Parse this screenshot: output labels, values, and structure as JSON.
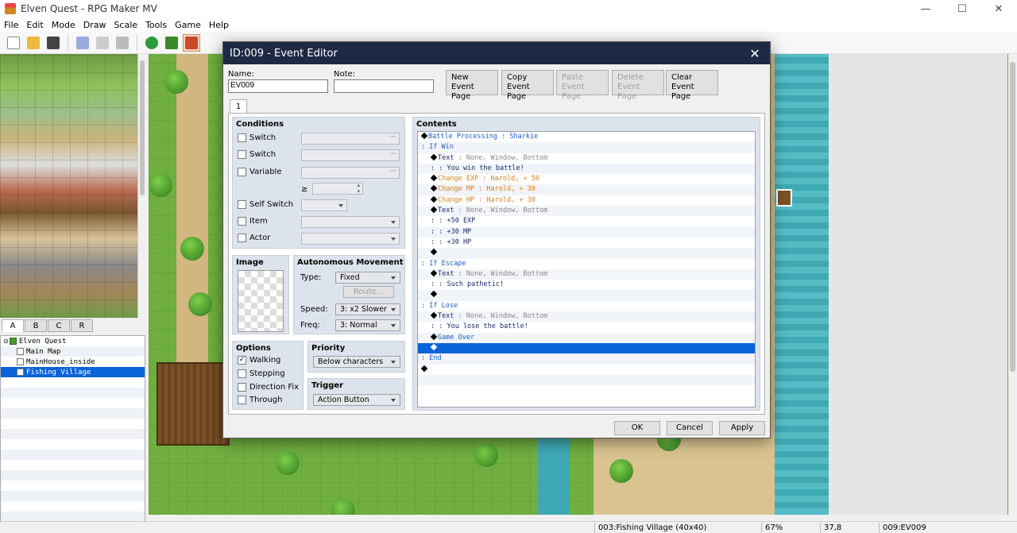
{
  "window": {
    "title": "Elven Quest - RPG Maker MV"
  },
  "menu": [
    "File",
    "Edit",
    "Mode",
    "Draw",
    "Scale",
    "Tools",
    "Game",
    "Help"
  ],
  "tileset_tabs": [
    "A",
    "B",
    "C",
    "R"
  ],
  "map_tree": [
    {
      "label": "Elven Quest",
      "indent": 0,
      "root": true
    },
    {
      "label": "Main Map",
      "indent": 1
    },
    {
      "label": "MainHouse_inside",
      "indent": 1
    },
    {
      "label": "Fishing Village",
      "indent": 1,
      "selected": true
    }
  ],
  "status": {
    "map": "003:Fishing Village (40x40)",
    "zoom": "67%",
    "coords": "37,8",
    "event": "009:EV009"
  },
  "dialog": {
    "title": "ID:009 - Event Editor",
    "name_label": "Name:",
    "name_value": "EV009",
    "note_label": "Note:",
    "note_value": "",
    "buttons": {
      "new": [
        "New",
        "Event Page"
      ],
      "copy": [
        "Copy",
        "Event Page"
      ],
      "paste": [
        "Paste",
        "Event Page"
      ],
      "delete": [
        "Delete",
        "Event Page"
      ],
      "clear": [
        "Clear",
        "Event Page"
      ]
    },
    "page_tab": "1",
    "conditions": {
      "title": "Conditions",
      "switch1": "Switch",
      "switch2": "Switch",
      "variable": "Variable",
      "gte": "≥",
      "self_switch": "Self Switch",
      "item": "Item",
      "actor": "Actor"
    },
    "image_title": "Image",
    "movement": {
      "title": "Autonomous Movement",
      "type_label": "Type:",
      "type_value": "Fixed",
      "route": "Route...",
      "speed_label": "Speed:",
      "speed_value": "3: x2 Slower",
      "freq_label": "Freq:",
      "freq_value": "3: Normal"
    },
    "options": {
      "title": "Options",
      "walking": "Walking",
      "stepping": "Stepping",
      "direction_fix": "Direction Fix",
      "through": "Through"
    },
    "priority": {
      "title": "Priority",
      "value": "Below characters"
    },
    "trigger": {
      "title": "Trigger",
      "value": "Action Button"
    },
    "contents_title": "Contents",
    "commands": [
      {
        "indent": 0,
        "diamond": true,
        "parts": [
          [
            "Battle Processing : Sharkie",
            "blue"
          ]
        ]
      },
      {
        "indent": 0,
        "parts": [
          [
            ": If Win",
            "blue"
          ]
        ]
      },
      {
        "indent": 1,
        "diamond": true,
        "parts": [
          [
            "Text",
            "navy"
          ],
          [
            " : None, Window, Bottom",
            "gray"
          ]
        ]
      },
      {
        "indent": 1,
        "parts": [
          [
            ":      : You win the battle!",
            "navy"
          ]
        ]
      },
      {
        "indent": 1,
        "diamond": true,
        "parts": [
          [
            "Change EXP : Harold, + 50",
            "orange"
          ]
        ]
      },
      {
        "indent": 1,
        "diamond": true,
        "parts": [
          [
            "Change MP : Harold, + 30",
            "orange"
          ]
        ]
      },
      {
        "indent": 1,
        "diamond": true,
        "parts": [
          [
            "Change HP : Harold, + 30",
            "orange"
          ]
        ]
      },
      {
        "indent": 1,
        "diamond": true,
        "parts": [
          [
            "Text",
            "navy"
          ],
          [
            " : None, Window, Bottom",
            "gray"
          ]
        ]
      },
      {
        "indent": 1,
        "parts": [
          [
            ":      : +50 EXP",
            "navy"
          ]
        ]
      },
      {
        "indent": 1,
        "parts": [
          [
            ":      : +30 MP",
            "navy"
          ]
        ]
      },
      {
        "indent": 1,
        "parts": [
          [
            ":      : +30 HP",
            "navy"
          ]
        ]
      },
      {
        "indent": 1,
        "diamond": true,
        "parts": []
      },
      {
        "indent": 0,
        "parts": [
          [
            ": If Escape",
            "blue"
          ]
        ]
      },
      {
        "indent": 1,
        "diamond": true,
        "parts": [
          [
            "Text",
            "navy"
          ],
          [
            " : None, Window, Bottom",
            "gray"
          ]
        ]
      },
      {
        "indent": 1,
        "parts": [
          [
            ":      : Such pathetic!",
            "navy"
          ]
        ]
      },
      {
        "indent": 1,
        "diamond": true,
        "parts": []
      },
      {
        "indent": 0,
        "parts": [
          [
            ": If Lose",
            "blue"
          ]
        ]
      },
      {
        "indent": 1,
        "diamond": true,
        "parts": [
          [
            "Text",
            "navy"
          ],
          [
            " : None, Window, Bottom",
            "gray"
          ]
        ]
      },
      {
        "indent": 1,
        "parts": [
          [
            ":      : You lose the battle!",
            "navy"
          ]
        ]
      },
      {
        "indent": 1,
        "diamond": true,
        "parts": [
          [
            "Game Over",
            "blue"
          ]
        ]
      },
      {
        "indent": 1,
        "diamond": true,
        "parts": [],
        "selected": true
      },
      {
        "indent": 0,
        "parts": [
          [
            ": End",
            "blue"
          ]
        ]
      },
      {
        "indent": 0,
        "diamond": true,
        "parts": []
      },
      {
        "indent": 0,
        "parts": []
      },
      {
        "indent": 0,
        "parts": []
      }
    ],
    "footer": {
      "ok": "OK",
      "cancel": "Cancel",
      "apply": "Apply"
    }
  }
}
